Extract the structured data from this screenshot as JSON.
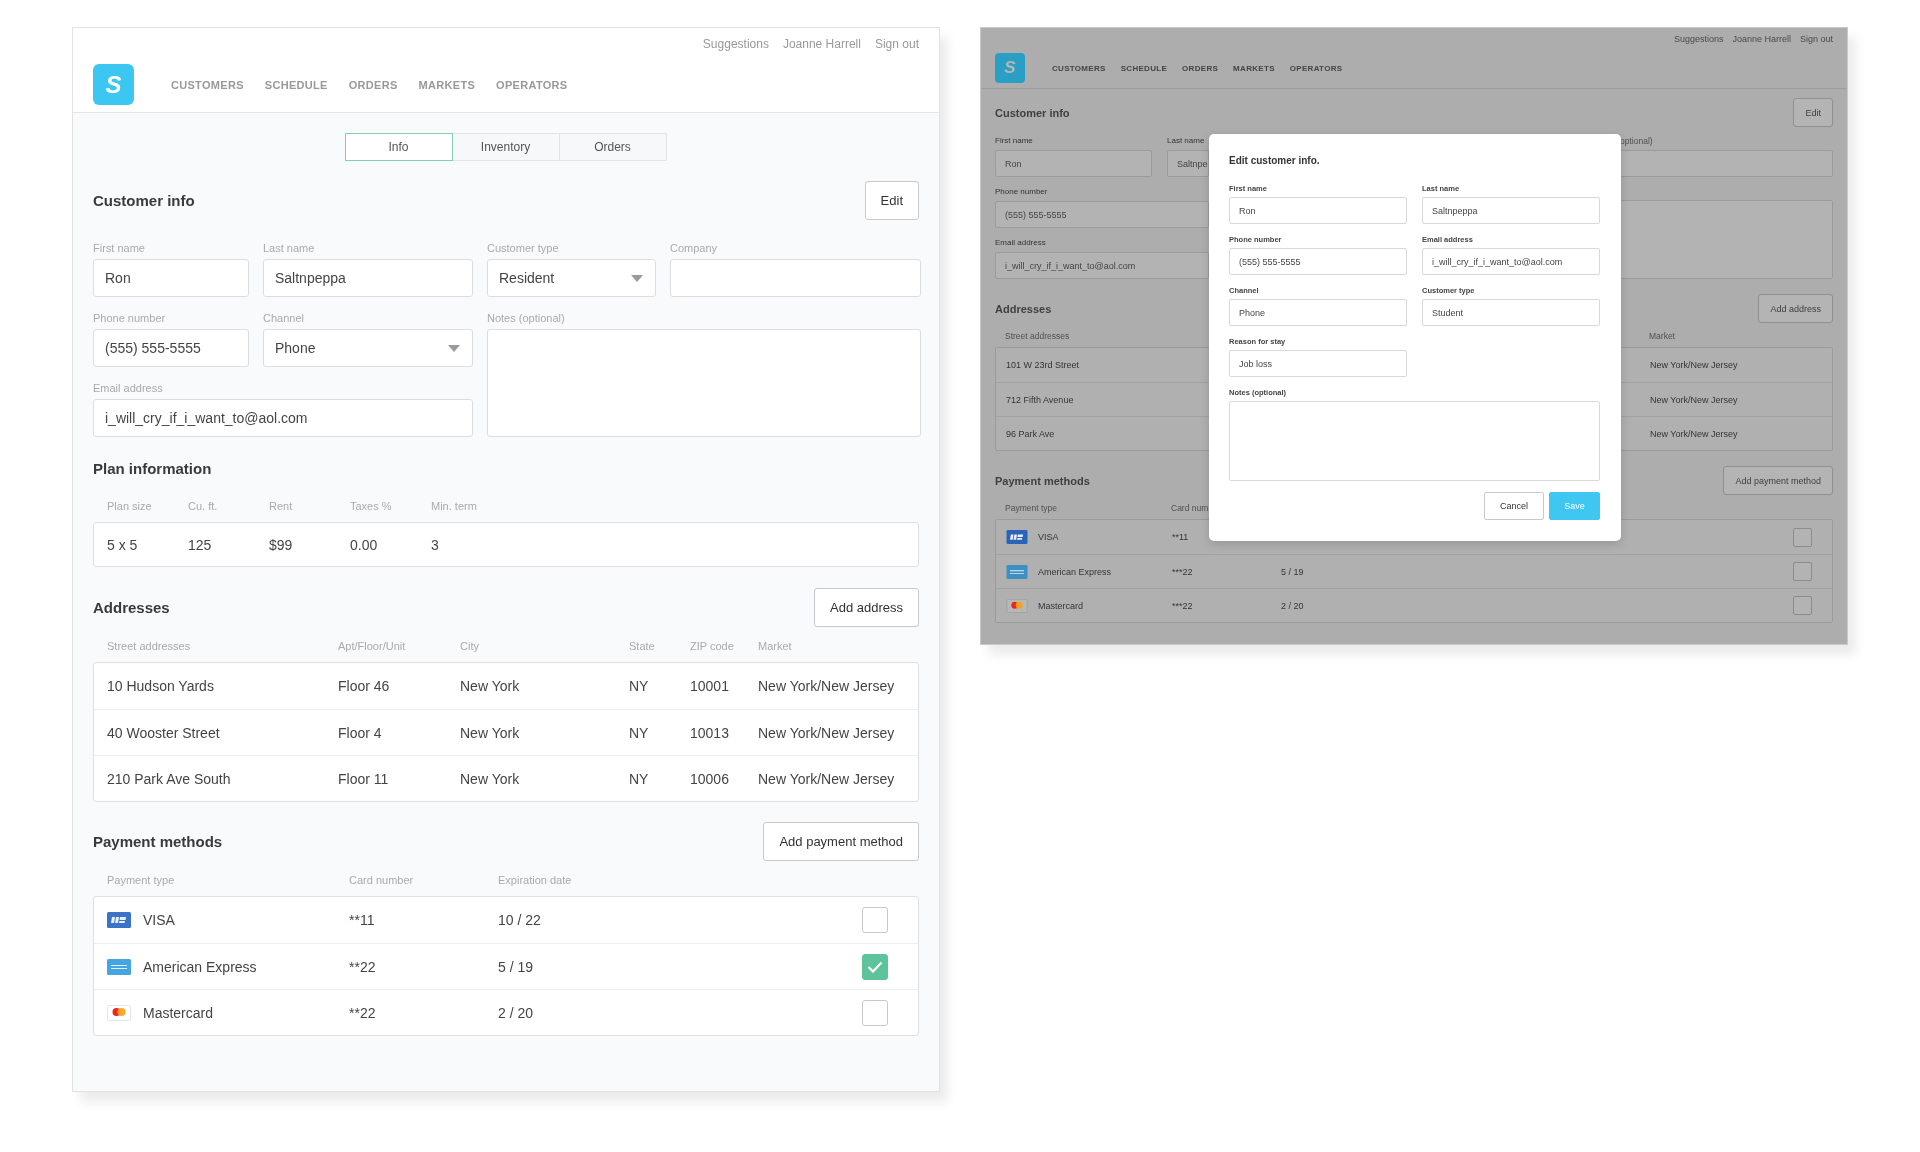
{
  "main_screen": {
    "top_links": [
      "Suggestions",
      "Joanne Harrell",
      "Sign out"
    ],
    "logo": "S",
    "nav": [
      "CUSTOMERS",
      "SCHEDULE",
      "ORDERS",
      "MARKETS",
      "OPERATORS"
    ],
    "tabs": [
      {
        "label": "Info",
        "selected": true
      },
      {
        "label": "Inventory",
        "selected": false
      },
      {
        "label": "Orders",
        "selected": false
      }
    ],
    "customer_info": {
      "title": "Customer info",
      "edit_button": "Edit",
      "fields": [
        {
          "label": "First name",
          "value": "Ron",
          "kind": "text"
        },
        {
          "label": "Last name",
          "value": "Saltnpeppa",
          "kind": "text"
        },
        {
          "label": "Customer type",
          "value": "Resident",
          "kind": "select"
        },
        {
          "label": "Company",
          "kind": "text"
        },
        {
          "label": "Phone number",
          "value": "(555) 555-5555",
          "kind": "text"
        },
        {
          "label": "Channel",
          "value": "Phone",
          "kind": "select"
        },
        {
          "label": "Notes (optional)",
          "kind": "textarea"
        },
        {
          "label": "Email address",
          "value": "i_will_cry_if_i_want_to@aol.com",
          "kind": "text"
        }
      ]
    },
    "plan": {
      "title": "Plan information",
      "columns": [
        "Plan size",
        "Cu. ft.",
        "Rent",
        "Taxes %",
        "Min. term"
      ],
      "values": [
        "5 x 5",
        "125",
        "$99",
        "0.00",
        "3"
      ]
    },
    "addresses": {
      "title": "Addresses",
      "add_button": "Add address",
      "columns": [
        "Street addresses",
        "Apt/Floor/Unit",
        "City",
        "State",
        "ZIP code",
        "Market"
      ],
      "rows": [
        [
          "10 Hudson Yards",
          "Floor 46",
          "New York",
          "NY",
          "10001",
          "New York/New Jersey"
        ],
        [
          "40 Wooster Street",
          "Floor 4",
          "New York",
          "NY",
          "10013",
          "New York/New Jersey"
        ],
        [
          "210 Park Ave South",
          "Floor 11",
          "New York",
          "NY",
          "10006",
          "New York/New Jersey"
        ]
      ]
    },
    "payments": {
      "title": "Payment methods",
      "add_button": "Add payment method",
      "columns": [
        "Payment type",
        "Card number",
        "Expiration date"
      ],
      "rows": [
        {
          "kind": "visa",
          "name": "VISA",
          "number": "**11",
          "expiry": "10 / 22",
          "checked": false
        },
        {
          "kind": "amex",
          "name": "American Express",
          "number": "**22",
          "expiry": "5 / 19",
          "checked": true
        },
        {
          "kind": "mastercard",
          "name": "Mastercard",
          "number": "**22",
          "expiry": "2 / 20",
          "checked": false
        }
      ]
    }
  },
  "modal_screen": {
    "background": {
      "top_links": [
        "Suggestions",
        "Joanne Harrell",
        "Sign out"
      ],
      "logo": "S",
      "nav": [
        "CUSTOMERS",
        "SCHEDULE",
        "ORDERS",
        "MARKETS",
        "OPERATORS"
      ],
      "title": "Customer info",
      "edit_button": "Edit",
      "fields": [
        {
          "label": "First name",
          "value": "Ron"
        },
        {
          "label": "Last name",
          "value": "Saltnpe"
        },
        {
          "label": "Phone number",
          "value": "(555) 555-5555"
        },
        {
          "label": "Email address",
          "value": "i_will_cry_if_i_want_to@aol.com"
        }
      ],
      "notes_label": "optional)",
      "addresses": {
        "title": "Addresses",
        "add_button": "Add address",
        "columns": [
          "Street addresses",
          "Market"
        ],
        "rows": [
          {
            "street": "101 W 23rd Street",
            "market": "New York/New Jersey"
          },
          {
            "street": "712 Fifth Avenue",
            "market": "New York/New Jersey"
          },
          {
            "street": "96 Park Ave",
            "market": "New York/New Jersey"
          }
        ]
      },
      "payments": {
        "title": "Payment methods",
        "add_button": "Add payment method",
        "columns": [
          "Payment type",
          "Card num"
        ],
        "rows": [
          {
            "kind": "visa",
            "name": "VISA",
            "number": "**11",
            "checked": false
          },
          {
            "kind": "amex",
            "name": "American Express",
            "number": "***22",
            "expiry": "5 / 19",
            "checked": false
          },
          {
            "kind": "mastercard",
            "name": "Mastercard",
            "number": "***22",
            "expiry": "2 / 20",
            "checked": false
          }
        ]
      }
    },
    "dialog": {
      "title": "Edit customer info.",
      "fields": [
        {
          "label": "First name",
          "value": "Ron",
          "kind": "text"
        },
        {
          "label": "Last name",
          "value": "Saltnpeppa",
          "kind": "text"
        },
        {
          "label": "Phone number",
          "value": "(555) 555-5555",
          "kind": "text"
        },
        {
          "label": "Email address",
          "value": "i_will_cry_if_i_want_to@aol.com",
          "kind": "text"
        },
        {
          "label": "Channel",
          "value": "Phone",
          "kind": "text"
        },
        {
          "label": "Customer type",
          "value": "Student",
          "kind": "text"
        },
        {
          "label": "Reason for stay",
          "value": "Job loss",
          "kind": "text"
        },
        {
          "label": "Notes (optional)",
          "kind": "textarea"
        }
      ],
      "buttons": [
        {
          "label": "Cancel",
          "kind": "secondary"
        },
        {
          "label": "Save",
          "kind": "primary"
        }
      ]
    }
  }
}
